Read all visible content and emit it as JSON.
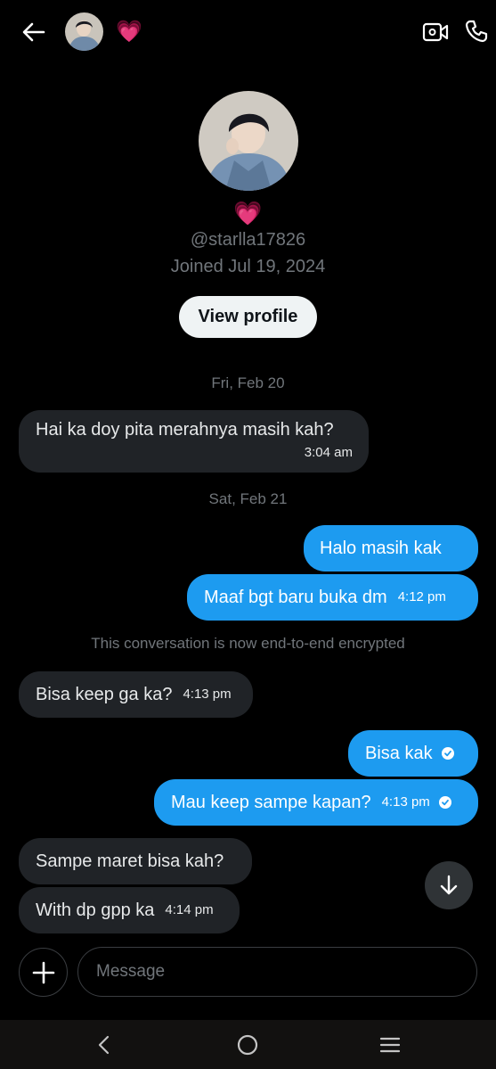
{
  "header": {
    "back_icon": "arrow-left-icon",
    "status_emoji": "💗",
    "video_icon": "video-camera-icon",
    "call_icon": "phone-icon"
  },
  "profile": {
    "emoji": "💗",
    "handle": "@starlla17826",
    "joined": "Joined Jul 19, 2024",
    "view_profile_label": "View profile"
  },
  "conversation": {
    "date1": "Fri, Feb 20",
    "date2": "Sat, Feb 21",
    "encrypted_note": "This conversation is now end-to-end encrypted",
    "messages": [
      {
        "direction": "in",
        "text": "Hai ka doy pita merahnya masih kah?",
        "time": "3:04 am"
      },
      {
        "direction": "out",
        "text": "Halo masih kak",
        "time": ""
      },
      {
        "direction": "out",
        "text": "Maaf bgt baru buka dm",
        "time": "4:12 pm"
      },
      {
        "direction": "in",
        "text": "Bisa keep ga ka?",
        "time": "4:13 pm"
      },
      {
        "direction": "out",
        "text": "Bisa kak",
        "time": "",
        "read": true
      },
      {
        "direction": "out",
        "text": "Mau keep sampe kapan?",
        "time": "4:13 pm",
        "read": true
      },
      {
        "direction": "in",
        "text": "Sampe maret bisa kah?",
        "time": ""
      },
      {
        "direction": "in",
        "text": "With dp gpp ka",
        "time": "4:14 pm"
      }
    ]
  },
  "composer": {
    "add_icon": "plus-icon",
    "placeholder": "Message"
  },
  "scroll_button_icon": "arrow-down-icon",
  "system_nav": {
    "back_icon": "chevron-left-icon",
    "home_icon": "circle-home-icon",
    "recents_icon": "menu-lines-icon"
  },
  "colors": {
    "background": "#000000",
    "incoming_bubble": "#202327",
    "outgoing_bubble": "#1d9bf0",
    "muted_text": "#71767b"
  }
}
